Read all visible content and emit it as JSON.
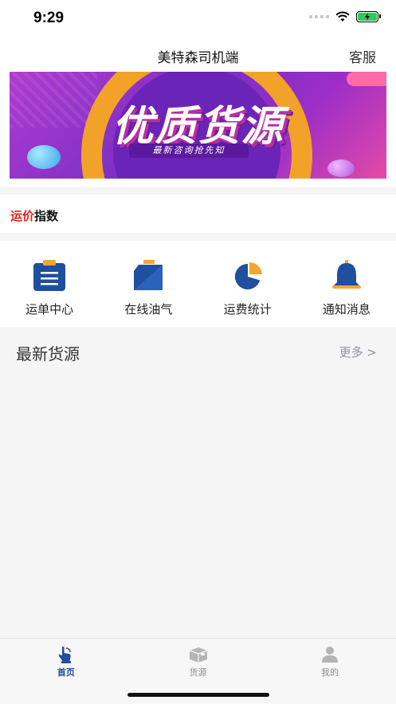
{
  "status": {
    "time": "9:29"
  },
  "header": {
    "title": "美特森司机端",
    "service_label": "客服"
  },
  "banner": {
    "title": "优质货源",
    "subtitle": "最新咨询抢先知"
  },
  "price_index": {
    "label_red": "运价",
    "label_dark": "指数"
  },
  "quick_menu": {
    "items": [
      {
        "label": "运单中心",
        "icon": "clipboard-icon"
      },
      {
        "label": "在线油气",
        "icon": "fuel-icon"
      },
      {
        "label": "运费统计",
        "icon": "pie-chart-icon"
      },
      {
        "label": "通知消息",
        "icon": "bell-icon"
      }
    ]
  },
  "latest": {
    "title": "最新货源",
    "more_label": "更多 >"
  },
  "tabs": [
    {
      "label": "首页",
      "icon": "home-hand-icon",
      "active": true
    },
    {
      "label": "货源",
      "icon": "package-icon",
      "active": false
    },
    {
      "label": "我的",
      "icon": "profile-icon",
      "active": false
    }
  ],
  "colors": {
    "accent": "#1f4f9e",
    "price_red": "#e0251f",
    "battery_green": "#34c759"
  }
}
